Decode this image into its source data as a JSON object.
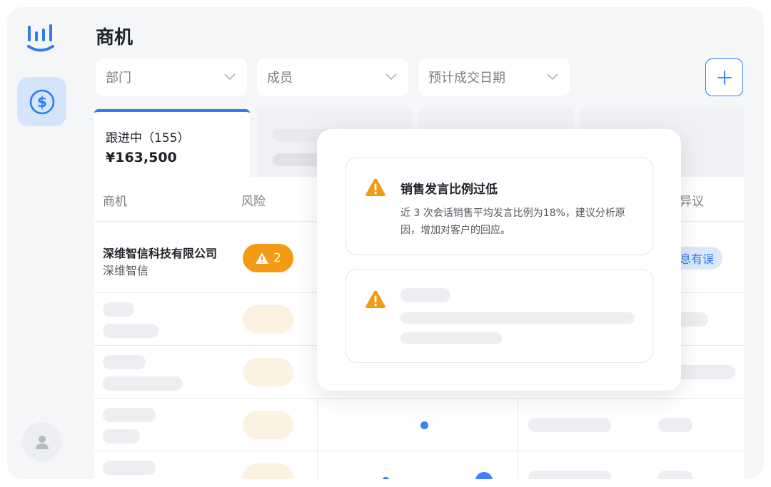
{
  "page": {
    "title": "商机"
  },
  "filters": [
    {
      "label": "部门"
    },
    {
      "label": "成员"
    },
    {
      "label": "预计成交日期"
    }
  ],
  "tab": {
    "title": "跟进中（155）",
    "amount": "¥163,500"
  },
  "table": {
    "headers": {
      "opportunity": "商机",
      "risk": "风险",
      "objection": "异议"
    },
    "row": {
      "company_name": "深维智信科技有限公司",
      "company_short": "深维智信",
      "risk_count": "2",
      "objection_tag": "息有误"
    }
  },
  "popover": {
    "alert": {
      "title": "销售发言比例过低",
      "description": "近 3 次会话销售平均发言比例为18%，建议分析原因，增加对客户的回应。"
    }
  },
  "icons": {
    "logo": "bar-chart-smile-icon",
    "nav": "dollar-circle-icon",
    "avatar": "user-icon",
    "add": "plus-icon",
    "dropdown": "chevron-down-icon",
    "warning": "warning-triangle-icon"
  },
  "colors": {
    "accent": "#2d7cf0",
    "warning": "#f59a15",
    "nav_active_bg": "#d4e5fb",
    "tag_bg": "#dce9fb"
  }
}
